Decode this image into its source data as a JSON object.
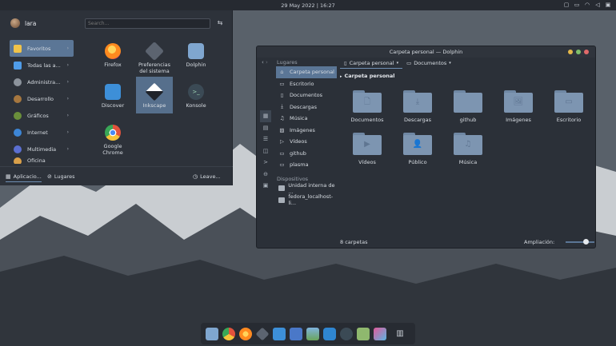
{
  "topbar": {
    "clock": "29 May 2022 | 16:27"
  },
  "launcher": {
    "username": "lara",
    "search_placeholder": "Search...",
    "categories": [
      {
        "label": "Favoritos",
        "color": "#f0c34a"
      },
      {
        "label": "Todas las a...",
        "color": "#4f9ce8"
      },
      {
        "label": "Administra...",
        "color": "#8c939c"
      },
      {
        "label": "Desarrollo",
        "color": "#a6773f"
      },
      {
        "label": "Gráficos",
        "color": "#6a8f3b"
      },
      {
        "label": "Internet",
        "color": "#3d86d6"
      },
      {
        "label": "Multimedia",
        "color": "#5b6fd1"
      },
      {
        "label": "Oficina",
        "color": "#d9a04a"
      }
    ],
    "apps": [
      {
        "label": "Firefox",
        "color": "#ff8a1f"
      },
      {
        "label": "Preferencias del sistema",
        "color": "#5c6470"
      },
      {
        "label": "Dolphin",
        "color": "#7fa6cf"
      },
      {
        "label": "Discover",
        "color": "#3d8fd8"
      },
      {
        "label": "Inkscape",
        "color": "#3a3f47"
      },
      {
        "label": "Konsole",
        "color": "#3b4a55"
      },
      {
        "label": "Google Chrome",
        "color": "#e2523c"
      }
    ],
    "footer": {
      "applications": "Aplicacio...",
      "places": "Lugares",
      "leave": "Leave..."
    }
  },
  "dolphin": {
    "title": "Carpeta personal — Dolphin",
    "places_title": "Lugares",
    "places": [
      "Carpeta personal",
      "Escritorio",
      "Documentos",
      "Descargas",
      "Música",
      "Imágenes",
      "Vídeos",
      "github",
      "plasma"
    ],
    "devices_title": "Dispositivos",
    "devices": [
      "Unidad interna de ...",
      "fedora_localhost-li..."
    ],
    "tabs": [
      "Carpeta personal",
      "Documentos"
    ],
    "path": "Carpeta personal",
    "folders": [
      {
        "label": "Documentos",
        "glyph": "🗋"
      },
      {
        "label": "Descargas",
        "glyph": "⤓"
      },
      {
        "label": "github",
        "glyph": ""
      },
      {
        "label": "Imágenes",
        "glyph": "🖼"
      },
      {
        "label": "Escritorio",
        "glyph": "▭"
      },
      {
        "label": "Vídeos",
        "glyph": "▶"
      },
      {
        "label": "Público",
        "glyph": "👤"
      },
      {
        "label": "Música",
        "glyph": "♫"
      }
    ],
    "status": "8 carpetas",
    "zoom_label": "Ampliación:"
  }
}
